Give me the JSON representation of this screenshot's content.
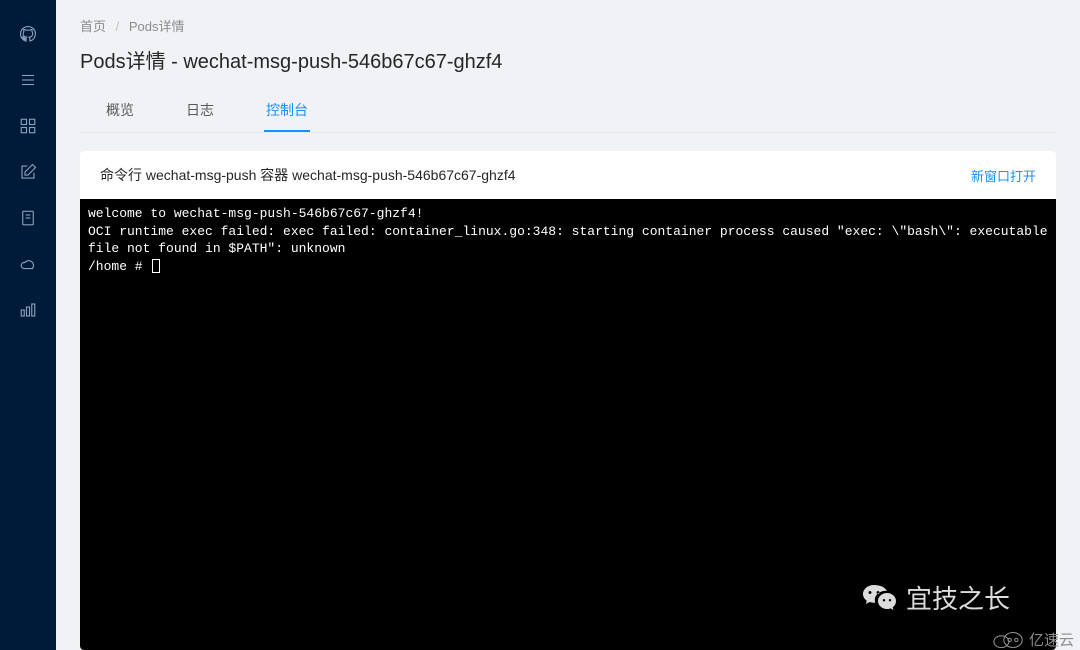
{
  "breadcrumb": {
    "home": "首页",
    "current": "Pods详情"
  },
  "title": "Pods详情 - wechat-msg-push-546b67c67-ghzf4",
  "tabs": {
    "overview": "概览",
    "logs": "日志",
    "console": "控制台"
  },
  "panel": {
    "head": "命令行 wechat-msg-push 容器 wechat-msg-push-546b67c67-ghzf4",
    "open_new": "新窗口打开"
  },
  "terminal": {
    "line1": "welcome to wechat-msg-push-546b67c67-ghzf4!",
    "line2": "OCI runtime exec failed: exec failed: container_linux.go:348: starting container process caused \"exec: \\\"bash\\\": executable file not found in $PATH\": unknown",
    "prompt": "/home # "
  },
  "watermarks": {
    "w1": "宜技之长",
    "w2": "亿速云"
  }
}
